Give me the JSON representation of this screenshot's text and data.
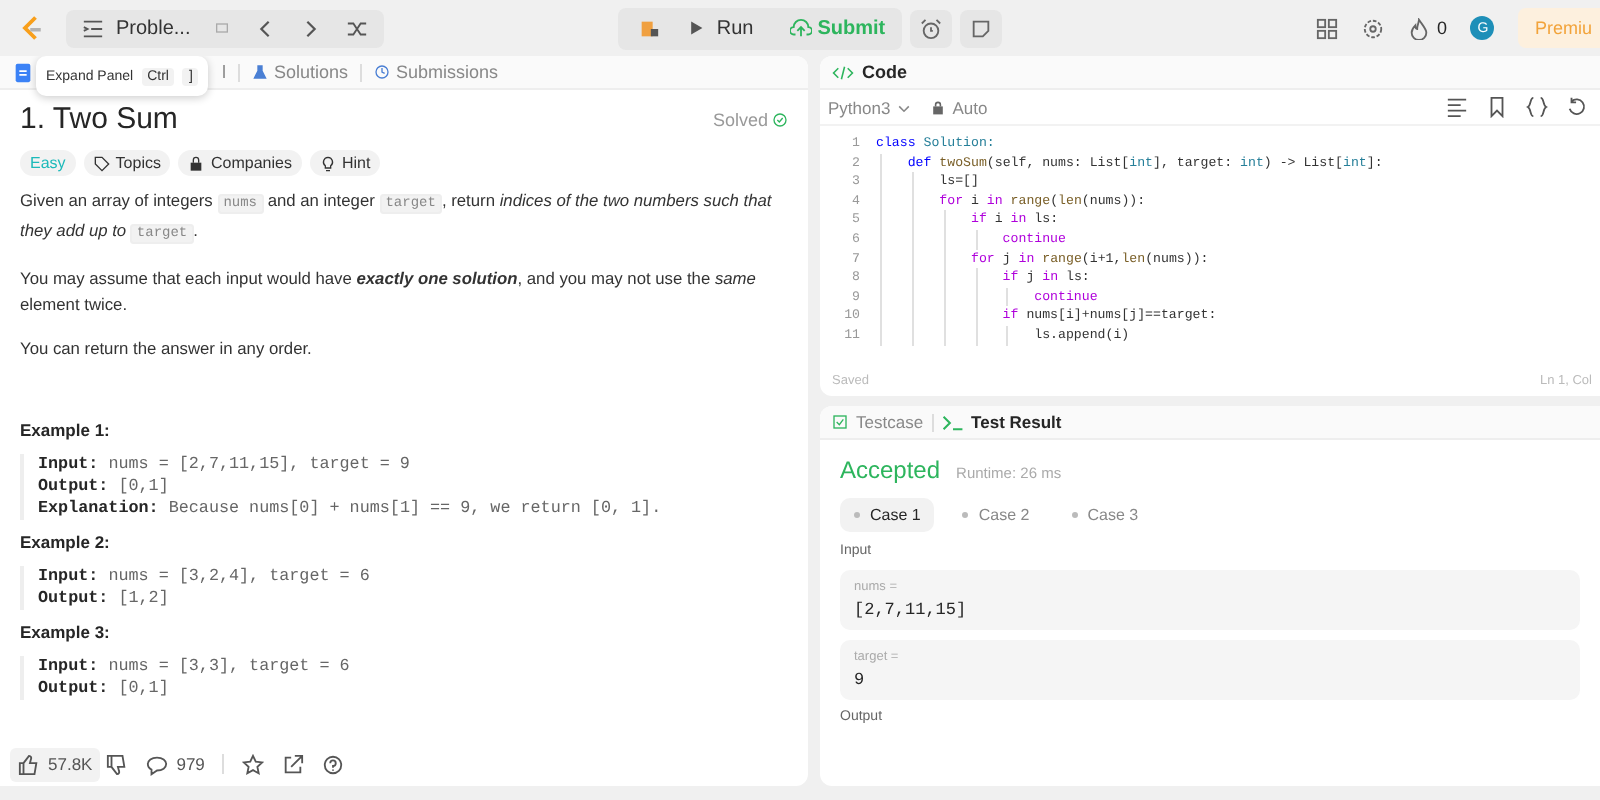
{
  "topbar": {
    "problem_list": "Proble...",
    "run": "Run",
    "submit": "Submit",
    "streak": "0",
    "avatar": "G",
    "premium": "Premiu"
  },
  "left_tabs": [
    {
      "label": "l",
      "selected": false
    },
    {
      "label": "Solutions",
      "selected": false
    },
    {
      "label": "Submissions",
      "selected": false
    }
  ],
  "tooltip": {
    "text": "Expand Panel",
    "keys": [
      "Ctrl",
      "]"
    ]
  },
  "problem": {
    "title": "1. Two Sum",
    "status": "Solved",
    "tags": [
      {
        "kind": "difficulty",
        "label": "Easy"
      },
      {
        "kind": "topics",
        "label": "Topics"
      },
      {
        "kind": "companies",
        "label": "Companies"
      },
      {
        "kind": "hint",
        "label": "Hint"
      }
    ],
    "paragraphs": [
      [
        {
          "kind": "text",
          "text": "Given an array of integers "
        },
        {
          "kind": "code",
          "text": "nums"
        },
        {
          "kind": "text",
          "text": " and an integer "
        },
        {
          "kind": "code",
          "text": "target"
        },
        {
          "kind": "text",
          "text": ", return "
        },
        {
          "kind": "italic",
          "text": "indices of the two numbers such that they add up to "
        },
        {
          "kind": "code",
          "text": "target"
        },
        {
          "kind": "text",
          "text": "."
        }
      ],
      [
        {
          "kind": "text",
          "text": "You may assume that each input would have "
        },
        {
          "kind": "bold",
          "text": "exactly one solution"
        },
        {
          "kind": "text",
          "text": ", and you may not use the "
        },
        {
          "kind": "italic",
          "text": "same"
        },
        {
          "kind": "text",
          "text": " element twice."
        }
      ],
      [
        {
          "kind": "text",
          "text": "You can return the answer in any order."
        }
      ]
    ],
    "examples": [
      {
        "title": "Example 1:",
        "lines": [
          {
            "label": "Input:",
            "value": "nums = [2,7,11,15], target = 9"
          },
          {
            "label": "Output:",
            "value": "[0,1]"
          },
          {
            "label": "Explanation:",
            "value": "Because nums[0] + nums[1] == 9, we return [0, 1]."
          }
        ]
      },
      {
        "title": "Example 2:",
        "lines": [
          {
            "label": "Input:",
            "value": "nums = [3,2,4], target = 6"
          },
          {
            "label": "Output:",
            "value": "[1,2]"
          }
        ]
      },
      {
        "title": "Example 3:",
        "lines": [
          {
            "label": "Input:",
            "value": "nums = [3,3], target = 6"
          },
          {
            "label": "Output:",
            "value": "[0,1]"
          }
        ]
      }
    ]
  },
  "footer": {
    "likes": "57.8K",
    "comments": "979"
  },
  "code": {
    "title": "Code",
    "language": "Python3",
    "mode": "Auto",
    "status": "Saved",
    "position": "Ln 1, Col",
    "lines": [
      {
        "n": "1",
        "tokens": [
          {
            "kind": "kw",
            "text": "class"
          },
          {
            "kind": "type",
            "text": " Solution:"
          }
        ]
      },
      {
        "n": "2",
        "tokens": [
          {
            "kind": "kw",
            "text": "    def"
          },
          {
            "kind": "func",
            "text": " twoSum"
          },
          {
            "kind": "plain",
            "text": "(self, nums: List["
          },
          {
            "kind": "type",
            "text": "int"
          },
          {
            "kind": "plain",
            "text": "], target: "
          },
          {
            "kind": "type",
            "text": "int"
          },
          {
            "kind": "plain",
            "text": ") -> List["
          },
          {
            "kind": "type",
            "text": "int"
          },
          {
            "kind": "plain",
            "text": "]:"
          }
        ]
      },
      {
        "n": "3",
        "tokens": [
          {
            "kind": "plain",
            "text": "        ls=[]"
          }
        ]
      },
      {
        "n": "4",
        "tokens": [
          {
            "kind": "ctl",
            "text": "        for"
          },
          {
            "kind": "plain",
            "text": " i "
          },
          {
            "kind": "ctl",
            "text": "in"
          },
          {
            "kind": "func",
            "text": " range"
          },
          {
            "kind": "plain",
            "text": "("
          },
          {
            "kind": "func",
            "text": "len"
          },
          {
            "kind": "plain",
            "text": "(nums)):"
          }
        ]
      },
      {
        "n": "5",
        "tokens": [
          {
            "kind": "ctl",
            "text": "            if"
          },
          {
            "kind": "plain",
            "text": " i "
          },
          {
            "kind": "ctl",
            "text": "in"
          },
          {
            "kind": "plain",
            "text": " ls:"
          }
        ]
      },
      {
        "n": "6",
        "tokens": [
          {
            "kind": "ctl",
            "text": "                continue"
          }
        ]
      },
      {
        "n": "7",
        "tokens": [
          {
            "kind": "ctl",
            "text": "            for"
          },
          {
            "kind": "plain",
            "text": " j "
          },
          {
            "kind": "ctl",
            "text": "in"
          },
          {
            "kind": "func",
            "text": " range"
          },
          {
            "kind": "plain",
            "text": "(i+1,"
          },
          {
            "kind": "func",
            "text": "len"
          },
          {
            "kind": "plain",
            "text": "(nums)):"
          }
        ]
      },
      {
        "n": "8",
        "tokens": [
          {
            "kind": "ctl",
            "text": "                if"
          },
          {
            "kind": "plain",
            "text": " j "
          },
          {
            "kind": "ctl",
            "text": "in"
          },
          {
            "kind": "plain",
            "text": " ls:"
          }
        ]
      },
      {
        "n": "9",
        "tokens": [
          {
            "kind": "ctl",
            "text": "                    continue"
          }
        ]
      },
      {
        "n": "10",
        "tokens": [
          {
            "kind": "ctl",
            "text": "                if"
          },
          {
            "kind": "plain",
            "text": " nums[i]+nums[j]==target:"
          }
        ]
      },
      {
        "n": "11",
        "tokens": [
          {
            "kind": "plain",
            "text": "                    ls.append(i)"
          }
        ]
      }
    ]
  },
  "result": {
    "tabs": [
      {
        "label": "Testcase",
        "selected": false
      },
      {
        "label": "Test Result",
        "selected": true
      }
    ],
    "verdict": "Accepted",
    "runtime": "Runtime: 26 ms",
    "cases": [
      {
        "label": "Case 1",
        "selected": true
      },
      {
        "label": "Case 2",
        "selected": false
      },
      {
        "label": "Case 3",
        "selected": false
      }
    ],
    "input_label": "Input",
    "inputs": [
      {
        "name": "nums =",
        "value": "[2,7,11,15]"
      },
      {
        "name": "target =",
        "value": "9"
      }
    ],
    "output_label": "Output"
  }
}
